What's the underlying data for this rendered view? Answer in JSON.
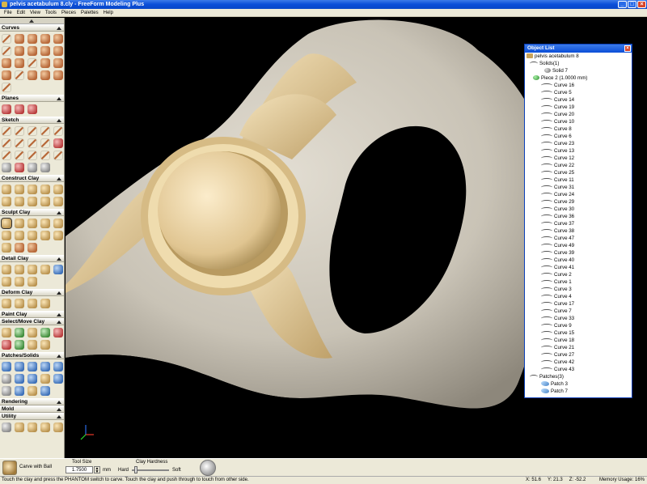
{
  "window": {
    "title": "pelvis acetabulum 8.cly - FreeForm Modeling Plus",
    "buttons": [
      "_",
      "□",
      "×"
    ]
  },
  "menu": [
    "File",
    "Edit",
    "View",
    "Tools",
    "Pieces",
    "Palettes",
    "Help"
  ],
  "palette_sections": [
    "Curves",
    "Planes",
    "Sketch",
    "Construct Clay",
    "Sculpt Clay",
    "Detail Clay",
    "Deform Clay",
    "Paint Clay",
    "Select/Move Clay",
    "Patches/Solids",
    "Rendering",
    "Mold",
    "Utility"
  ],
  "object_list": {
    "title": "Object List",
    "root": "pelvis acetabulum 8",
    "solids_group": "Solids(1)",
    "solid": "Solid 7",
    "piece": "Piece 2 (1.0000 mm)",
    "curves": [
      "Curve 16",
      "Curve 5",
      "Curve 14",
      "Curve 19",
      "Curve 20",
      "Curve 10",
      "Curve 8",
      "Curve 6",
      "Curve 23",
      "Curve 13",
      "Curve 12",
      "Curve 22",
      "Curve 25",
      "Curve 11",
      "Curve 31",
      "Curve 24",
      "Curve 29",
      "Curve 30",
      "Curve 36",
      "Curve 37",
      "Curve 38",
      "Curve 47",
      "Curve 49",
      "Curve 39",
      "Curve 40",
      "Curve 41",
      "Curve 2",
      "Curve 1",
      "Curve 3",
      "Curve 4",
      "Curve 17",
      "Curve 7",
      "Curve 33",
      "Curve 9",
      "Curve 15",
      "Curve 18",
      "Curve 21",
      "Curve 27",
      "Curve 42",
      "Curve 43"
    ],
    "patches_group": "Patches(3)",
    "patches": [
      "Patch 3",
      "Patch 7"
    ]
  },
  "tool": {
    "name": "Carve with Ball",
    "size_label": "Tool Size",
    "size_value": "1.7500",
    "unit": "mm",
    "hardness_label": "Clay Hardness",
    "hard": "Hard",
    "soft": "Soft"
  },
  "status": {
    "message": "Touch the clay and press the PHANTOM switch to carve. Touch the clay and push through to touch from other side.",
    "x": "X: 51.6",
    "y": "Y: 21.3",
    "z": "Z: -52.2",
    "memory": "Memory Usage: 16%"
  },
  "colors": {
    "bone": "#d2cdc2",
    "implant": "#e8d3a2",
    "titlebar": "#0a4ed8"
  }
}
